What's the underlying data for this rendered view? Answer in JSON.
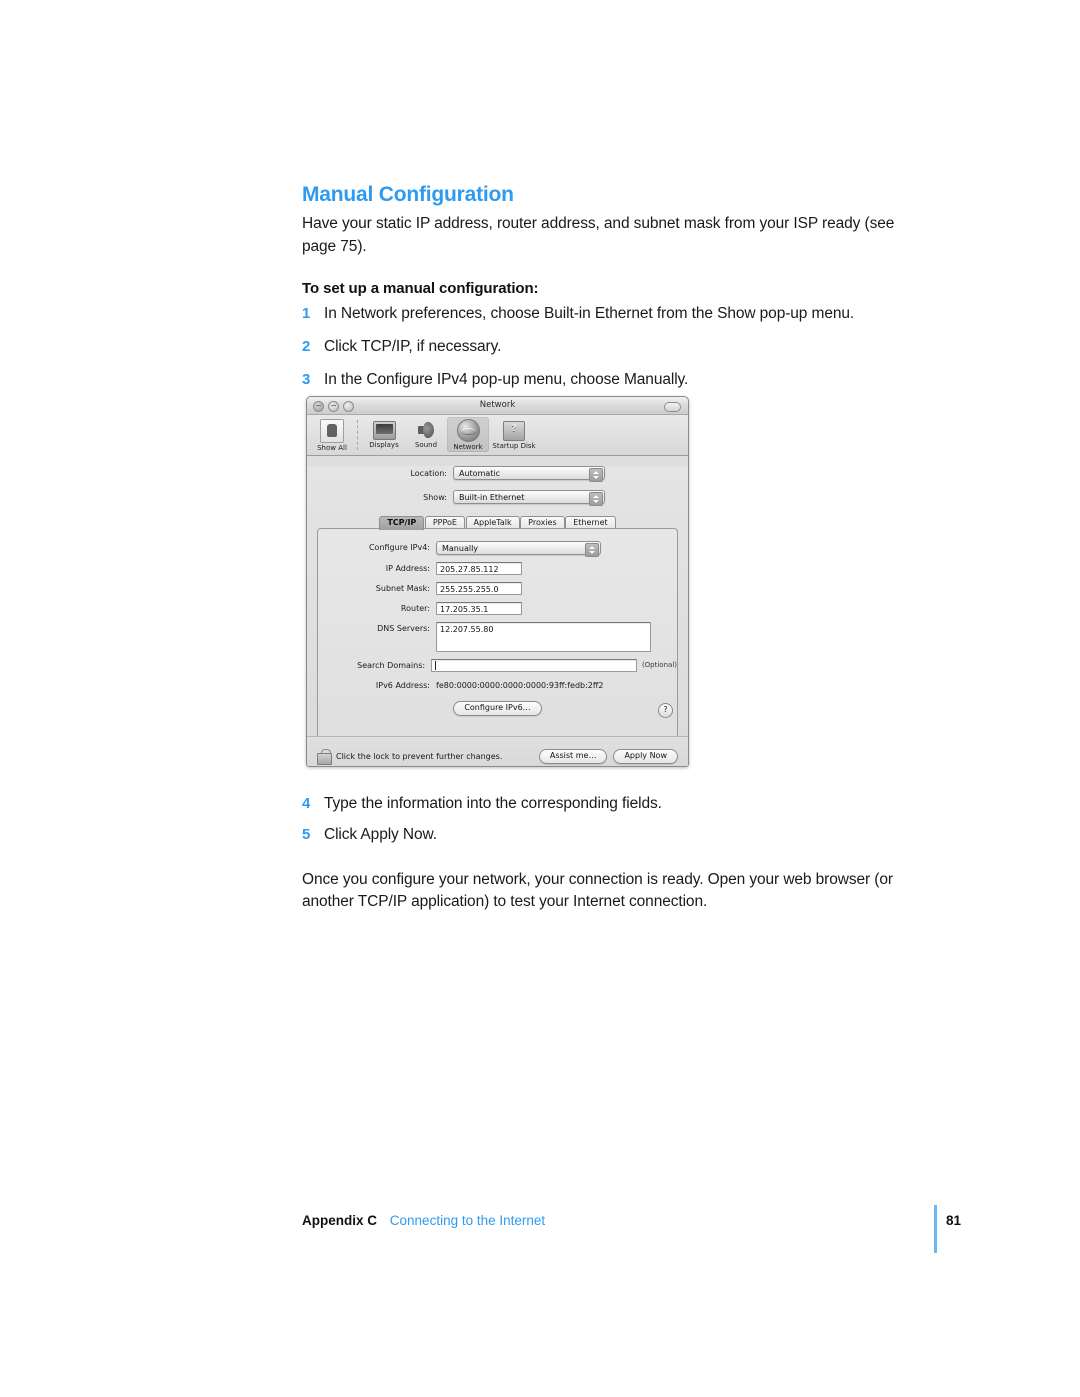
{
  "document": {
    "heading": "Manual Configuration",
    "lead": "Have your static IP address, router address, and subnet mask from your ISP ready (see page 75).",
    "subhead": "To set up a manual configuration:",
    "steps_before": [
      {
        "num": "1",
        "text": "In Network preferences, choose Built-in Ethernet from the Show pop-up menu."
      },
      {
        "num": "2",
        "text": "Click TCP/IP, if necessary."
      },
      {
        "num": "3",
        "text": "In the Configure IPv4 pop-up menu, choose Manually."
      }
    ],
    "steps_after": [
      {
        "num": "4",
        "text": "Type the information into the corresponding fields."
      },
      {
        "num": "5",
        "text": "Click Apply Now."
      }
    ],
    "closing": "Once you configure your network, your connection is ready. Open your web browser (or another TCP/IP application) to test your Internet connection.",
    "footer": {
      "appendix": "Appendix C",
      "title": "Connecting to the Internet",
      "page_number": "81"
    },
    "accent_color": "#2e9bf0"
  },
  "screenshot": {
    "window_title": "Network",
    "toolbar": [
      {
        "label": "Show All",
        "icon": "show-all-icon",
        "selected": false
      },
      {
        "label": "Displays",
        "icon": "displays-icon",
        "selected": false
      },
      {
        "label": "Sound",
        "icon": "sound-icon",
        "selected": false
      },
      {
        "label": "Network",
        "icon": "network-globe-icon",
        "selected": true
      },
      {
        "label": "Startup Disk",
        "icon": "startup-disk-icon",
        "selected": false
      }
    ],
    "location": {
      "label": "Location:",
      "value": "Automatic"
    },
    "show": {
      "label": "Show:",
      "value": "Built-in Ethernet"
    },
    "tabs": [
      {
        "label": "TCP/IP",
        "active": true
      },
      {
        "label": "PPPoE",
        "active": false
      },
      {
        "label": "AppleTalk",
        "active": false
      },
      {
        "label": "Proxies",
        "active": false
      },
      {
        "label": "Ethernet",
        "active": false
      }
    ],
    "fields": {
      "configure_ipv4": {
        "label": "Configure IPv4:",
        "value": "Manually"
      },
      "ip_address": {
        "label": "IP Address:",
        "value": "205.27.85.112"
      },
      "subnet_mask": {
        "label": "Subnet Mask:",
        "value": "255.255.255.0"
      },
      "router": {
        "label": "Router:",
        "value": "17.205.35.1"
      },
      "dns_servers": {
        "label": "DNS Servers:",
        "value": "12.207.55.80"
      },
      "search_domains": {
        "label": "Search Domains:",
        "value": "",
        "hint": "(Optional)"
      },
      "ipv6_address": {
        "label": "IPv6 Address:",
        "value": "fe80:0000:0000:0000:0000:93ff:fedb:2ff2"
      }
    },
    "configure_ipv6_button": "Configure IPv6…",
    "help_button": "?",
    "lock_text": "Click the lock to prevent further changes.",
    "assist_button": "Assist me…",
    "apply_button": "Apply Now"
  }
}
